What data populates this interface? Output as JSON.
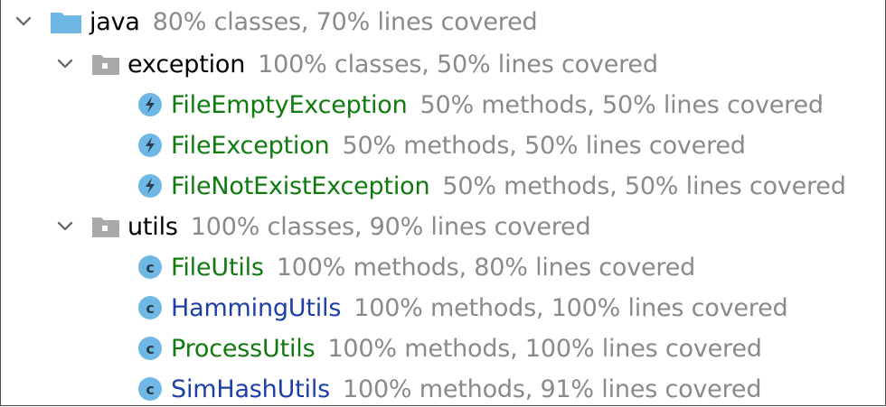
{
  "tree": {
    "root": {
      "name": "java",
      "stats": "80% classes, 70% lines covered",
      "icon": "folder-icon",
      "expanded": true
    },
    "packages": [
      {
        "name": "exception",
        "stats": "100% classes, 50% lines covered",
        "icon": "package-icon",
        "expanded": true,
        "items": [
          {
            "name": "FileEmptyException",
            "stats": "50% methods, 50% lines covered",
            "icon": "exception-class-icon",
            "color": "#0f7b0f"
          },
          {
            "name": "FileException",
            "stats": "50% methods, 50% lines covered",
            "icon": "exception-class-icon",
            "color": "#0f7b0f"
          },
          {
            "name": "FileNotExistException",
            "stats": "50% methods, 50% lines covered",
            "icon": "exception-class-icon",
            "color": "#0f7b0f"
          }
        ]
      },
      {
        "name": "utils",
        "stats": "100% classes, 90% lines covered",
        "icon": "package-icon",
        "expanded": true,
        "items": [
          {
            "name": "FileUtils",
            "stats": "100% methods, 80% lines covered",
            "icon": "class-icon",
            "color": "#0f7b0f"
          },
          {
            "name": "HammingUtils",
            "stats": "100% methods, 100% lines covered",
            "icon": "class-icon",
            "color": "#1d3fa8"
          },
          {
            "name": "ProcessUtils",
            "stats": "100% methods, 100% lines covered",
            "icon": "class-icon",
            "color": "#0f7b0f"
          },
          {
            "name": "SimHashUtils",
            "stats": "100% methods, 91% lines covered",
            "icon": "class-icon",
            "color": "#1d3fa8"
          }
        ]
      }
    ]
  },
  "colors": {
    "green": "#0f7b0f",
    "blue": "#1d3fa8",
    "stats_gray": "#8a8a8a",
    "folder_blue": "#6fb8e6",
    "package_gray": "#a9a9a9",
    "class_icon_blue": "#6fb8e6"
  }
}
